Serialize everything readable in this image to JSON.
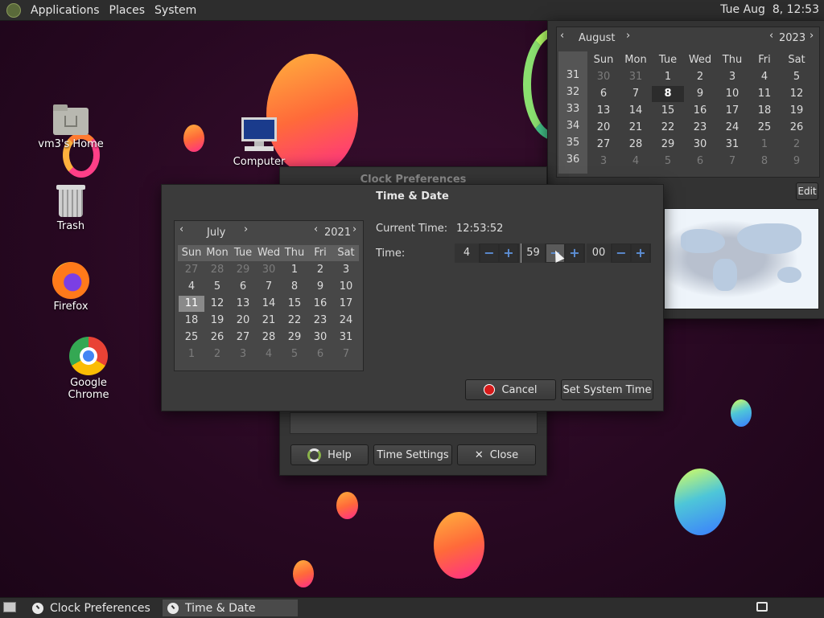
{
  "top_panel": {
    "menus": [
      "Applications",
      "Places",
      "System"
    ],
    "clock": "Tue Aug  8, 12:53"
  },
  "desktop_icons": [
    {
      "name": "vm3's Home"
    },
    {
      "name": "Computer"
    },
    {
      "name": "Trash"
    },
    {
      "name": "Firefox"
    },
    {
      "name": "Google Chrome"
    }
  ],
  "popup_calendar": {
    "month": "August",
    "year": "2023",
    "weekdays": [
      "Sun",
      "Mon",
      "Tue",
      "Wed",
      "Thu",
      "Fri",
      "Sat"
    ],
    "weeks": [
      "31",
      "32",
      "33",
      "34",
      "35",
      "36"
    ],
    "days": [
      [
        "30",
        "31",
        "1",
        "2",
        "3",
        "4",
        "5"
      ],
      [
        "6",
        "7",
        "8",
        "9",
        "10",
        "11",
        "12"
      ],
      [
        "13",
        "14",
        "15",
        "16",
        "17",
        "18",
        "19"
      ],
      [
        "20",
        "21",
        "22",
        "23",
        "24",
        "25",
        "26"
      ],
      [
        "27",
        "28",
        "29",
        "30",
        "31",
        "1",
        "2"
      ],
      [
        "3",
        "4",
        "5",
        "6",
        "7",
        "8",
        "9"
      ]
    ],
    "dim_flags": [
      [
        1,
        1,
        0,
        0,
        0,
        0,
        0
      ],
      [
        0,
        0,
        0,
        0,
        0,
        0,
        0
      ],
      [
        0,
        0,
        0,
        0,
        0,
        0,
        0
      ],
      [
        0,
        0,
        0,
        0,
        0,
        0,
        0
      ],
      [
        0,
        0,
        0,
        0,
        0,
        1,
        1
      ],
      [
        1,
        1,
        1,
        1,
        1,
        1,
        1
      ]
    ],
    "today": "8",
    "edit_label": "Edit"
  },
  "clock_prefs": {
    "title": "Clock Preferences",
    "help_label": "Help",
    "time_settings_label": "Time Settings",
    "close_label": "Close"
  },
  "time_date": {
    "title": "Time & Date",
    "month": "July",
    "year": "2021",
    "weekdays": [
      "Sun",
      "Mon",
      "Tue",
      "Wed",
      "Thu",
      "Fri",
      "Sat"
    ],
    "days": [
      [
        "27",
        "28",
        "29",
        "30",
        "1",
        "2",
        "3"
      ],
      [
        "4",
        "5",
        "6",
        "7",
        "8",
        "9",
        "10"
      ],
      [
        "11",
        "12",
        "13",
        "14",
        "15",
        "16",
        "17"
      ],
      [
        "18",
        "19",
        "20",
        "21",
        "22",
        "23",
        "24"
      ],
      [
        "25",
        "26",
        "27",
        "28",
        "29",
        "30",
        "31"
      ],
      [
        "1",
        "2",
        "3",
        "4",
        "5",
        "6",
        "7"
      ]
    ],
    "dim_flags": [
      [
        1,
        1,
        1,
        1,
        0,
        0,
        0
      ],
      [
        0,
        0,
        0,
        0,
        0,
        0,
        0
      ],
      [
        0,
        0,
        0,
        0,
        0,
        0,
        0
      ],
      [
        0,
        0,
        0,
        0,
        0,
        0,
        0
      ],
      [
        0,
        0,
        0,
        0,
        0,
        0,
        0
      ],
      [
        1,
        1,
        1,
        1,
        1,
        1,
        1
      ]
    ],
    "selected": "11",
    "current_time_label": "Current Time:",
    "current_time_value": "12:53:52",
    "time_label": "Time:",
    "hour": "4",
    "minute": "59",
    "second": "00",
    "cancel_label": "Cancel",
    "set_label": "Set System Time"
  },
  "taskbar": {
    "tasks": [
      "Clock Preferences",
      "Time & Date"
    ]
  }
}
